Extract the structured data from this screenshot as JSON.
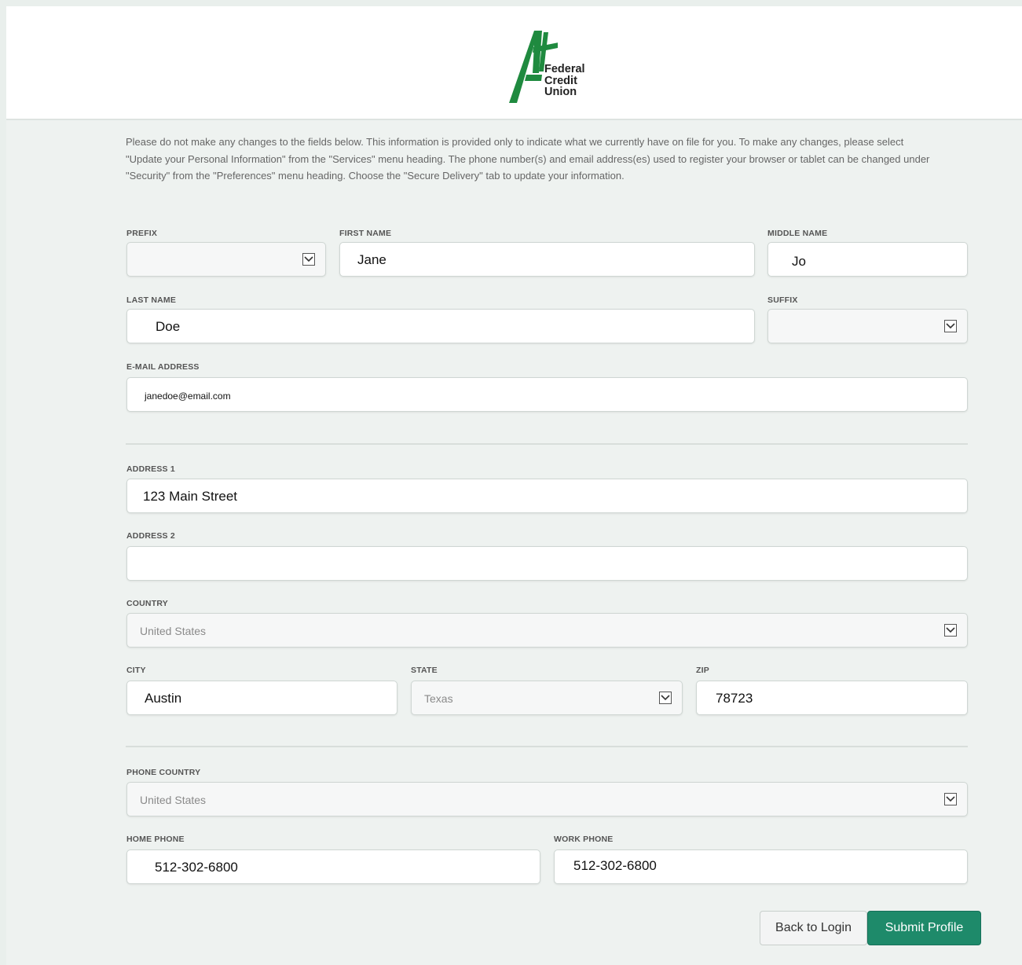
{
  "brand": {
    "logo_text_1": "Federal",
    "logo_text_2": "Credit",
    "logo_text_3": "Union",
    "logo_mark": "A+",
    "accent_color": "#1f8a3f",
    "button_color": "#1e8a6a"
  },
  "notice": "Please do not make any changes to the fields below. This information is provided only to indicate what we currently have on file for you. To make any changes, please select \"Update your Personal Information\" from the \"Services\" menu heading. The phone number(s) and email address(es) used to register your browser or tablet can be changed under \"Security\" from the \"Preferences\" menu heading. Choose the \"Secure Delivery\" tab to update your information.",
  "fields": {
    "prefix": {
      "label": "PREFIX",
      "value": ""
    },
    "first_name": {
      "label": "FIRST NAME",
      "value": "Jane"
    },
    "middle_name": {
      "label": "MIDDLE NAME",
      "value": "Jo"
    },
    "last_name": {
      "label": "LAST NAME",
      "value": "Doe"
    },
    "suffix": {
      "label": "SUFFIX",
      "value": ""
    },
    "email": {
      "label": "E-MAIL ADDRESS",
      "value": "janedoe@email.com"
    },
    "address1": {
      "label": "ADDRESS 1",
      "value": "123 Main Street"
    },
    "address2": {
      "label": "ADDRESS 2",
      "value": ""
    },
    "country": {
      "label": "COUNTRY",
      "value": "United States"
    },
    "city": {
      "label": "CITY",
      "value": "Austin"
    },
    "state": {
      "label": "STATE",
      "value": "Texas"
    },
    "zip": {
      "label": "ZIP",
      "value": "78723"
    },
    "phone_country": {
      "label": "PHONE COUNTRY",
      "value": "United States"
    },
    "home_phone": {
      "label": "HOME PHONE",
      "value": "512-302-6800"
    },
    "work_phone": {
      "label": "WORK PHONE",
      "value": "512-302-6800"
    }
  },
  "buttons": {
    "back": "Back to Login",
    "submit": "Submit Profile"
  },
  "icons": {
    "dropdown": "chevron-down-box-icon"
  }
}
